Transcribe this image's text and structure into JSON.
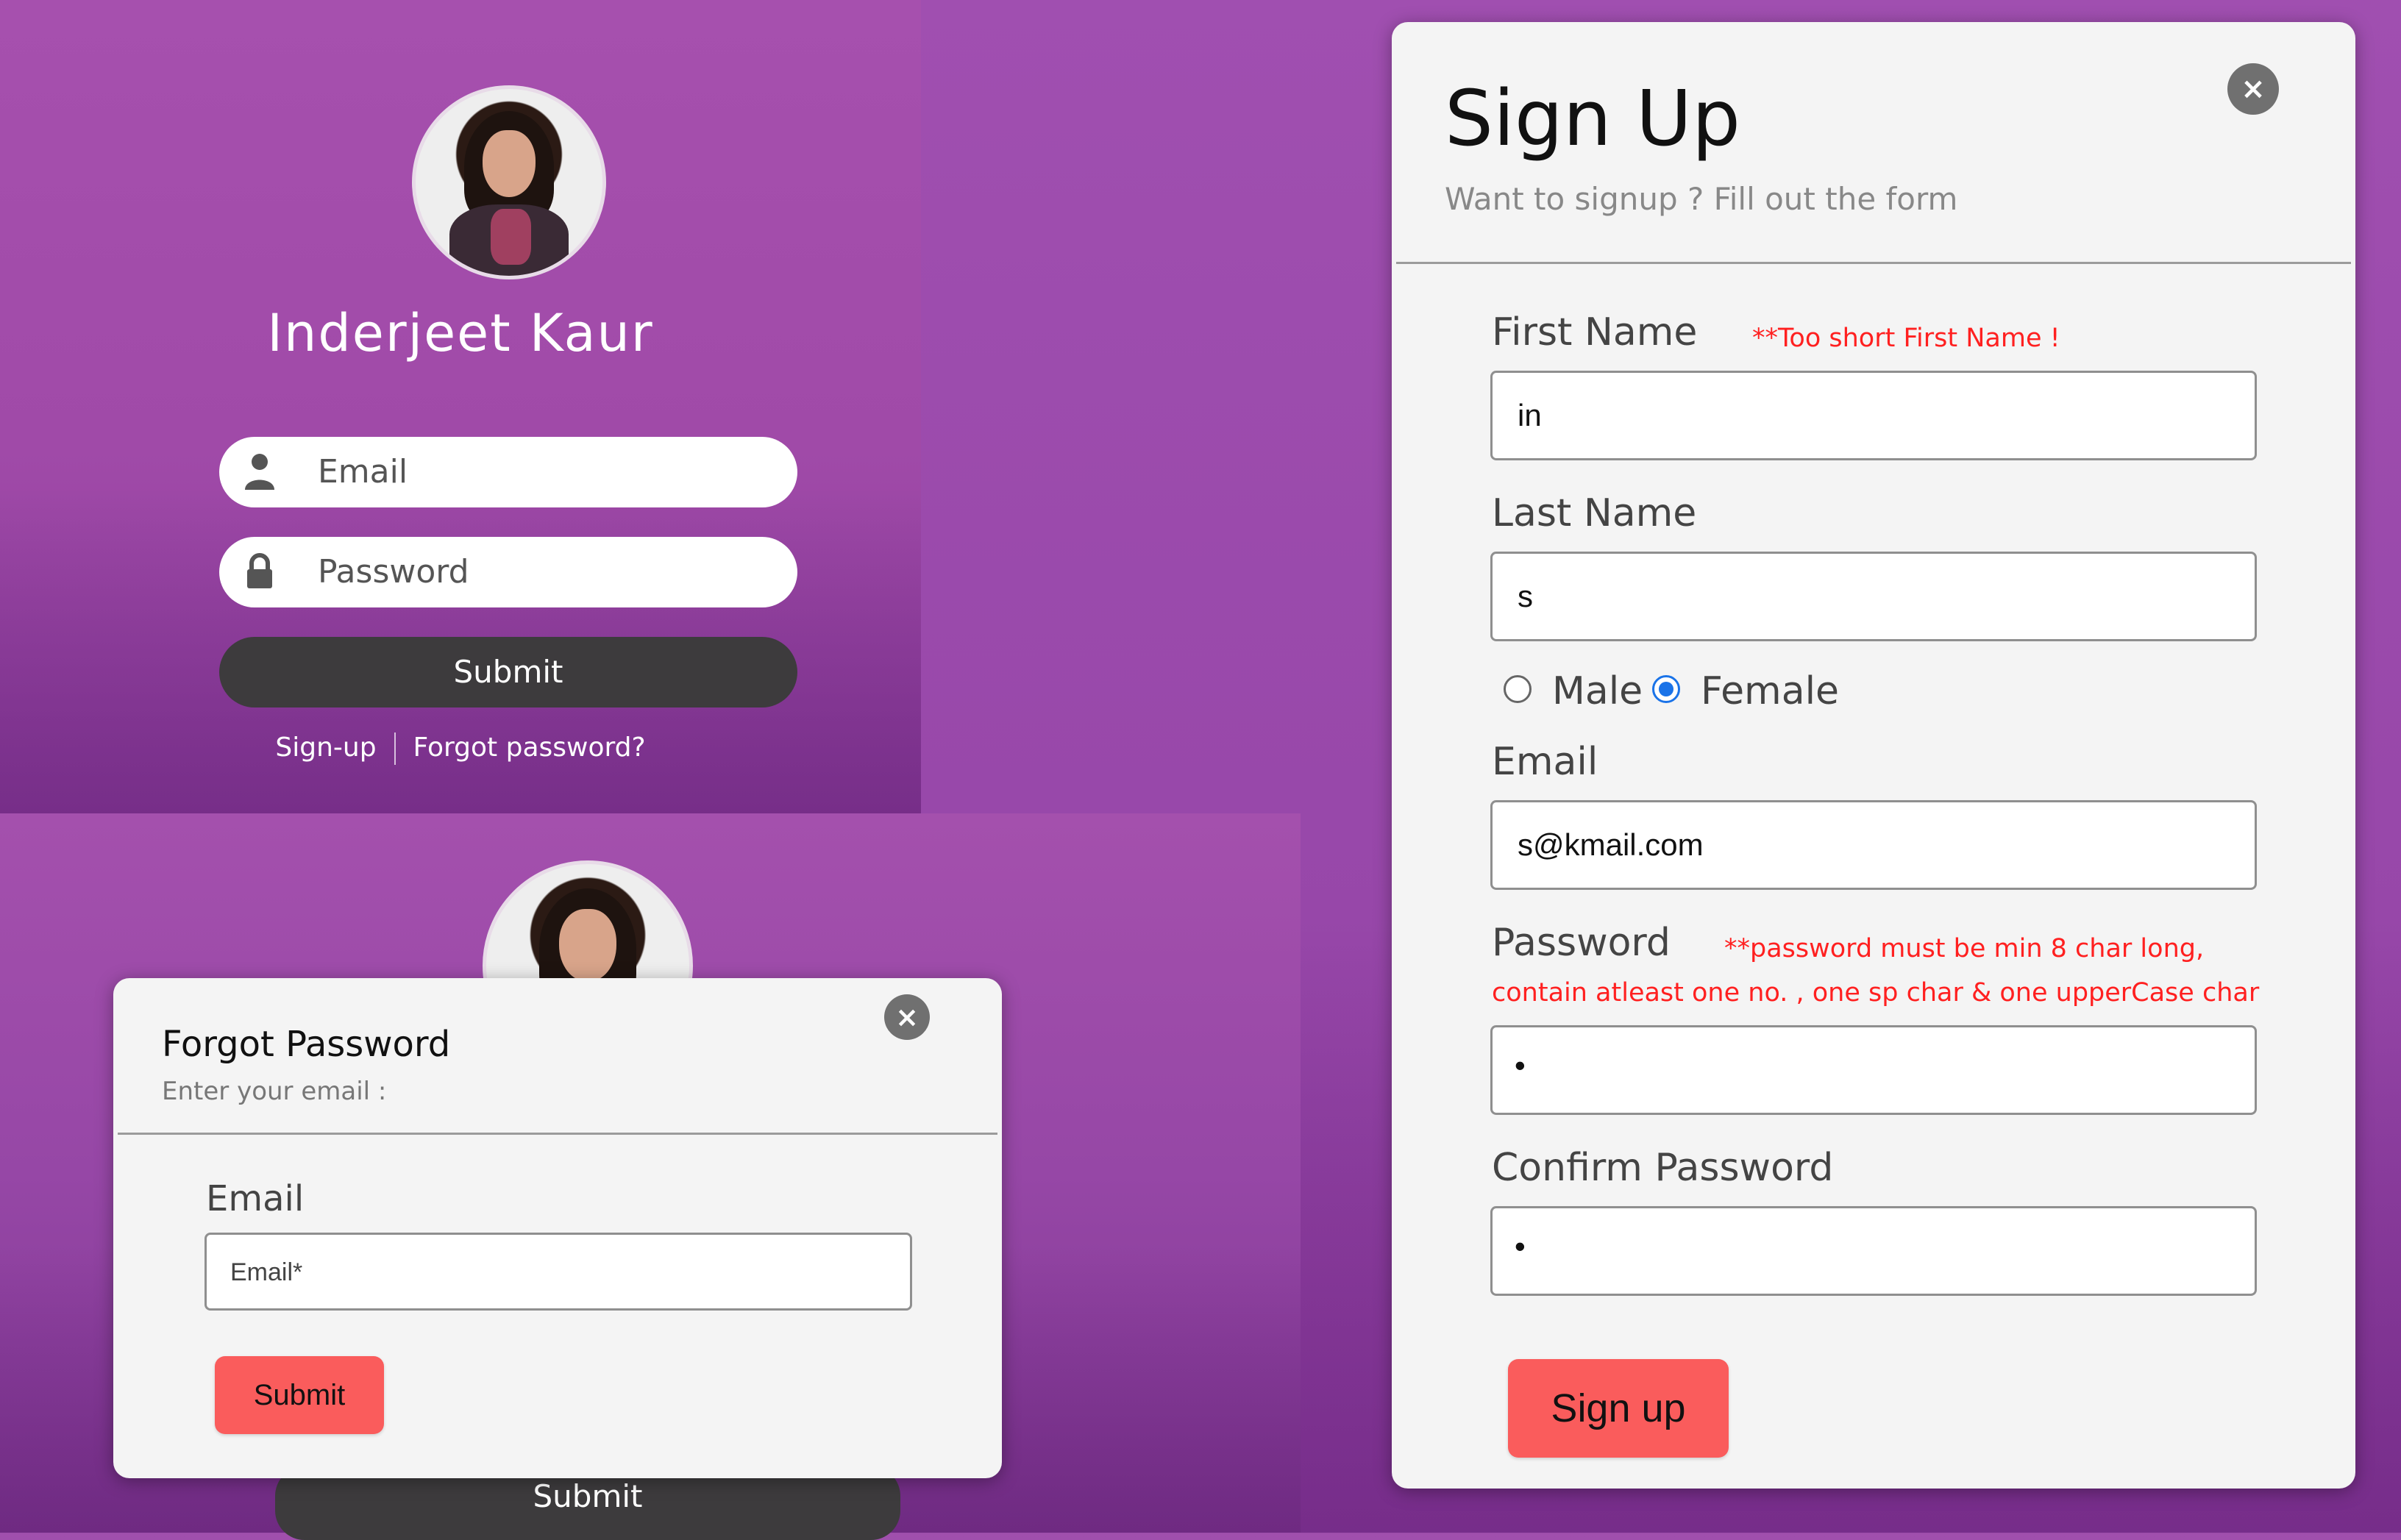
{
  "login": {
    "name": "Inderjeet Kaur",
    "email_placeholder": "Email",
    "password_placeholder": "Password",
    "submit_label": "Submit",
    "signup_link": "Sign-up",
    "forgot_link": "Forgot  password?"
  },
  "background_submit_label": "Submit",
  "forgot_modal": {
    "title": "Forgot Password",
    "subtitle": "Enter your email :",
    "close": "×",
    "email_label": "Email",
    "email_placeholder": "Email*",
    "submit_label": "Submit"
  },
  "signup_modal": {
    "title": "Sign Up",
    "subtitle": "Want to signup ? Fill out the form",
    "close": "×",
    "first_name_label": "First Name",
    "first_name_error": "**Too short First Name !",
    "first_name_value": "in",
    "last_name_label": "Last Name",
    "last_name_value": "s",
    "gender_options": [
      "Male",
      "Female"
    ],
    "gender_selected": "Female",
    "email_label": "Email",
    "email_value": "s@kmail.com",
    "password_label": "Password",
    "password_error_line1": "**password must be min 8 char long,",
    "password_error_line2": "contain atleast one no. , one sp char & one upperCase char",
    "password_value": "•",
    "confirm_password_label": "Confirm Password",
    "confirm_password_value": "•",
    "signup_label": "Sign up"
  },
  "colors": {
    "background_purple": "#a04fad",
    "dark_button": "#3d3b3d",
    "red_button": "#fa5c5c",
    "error_text": "#ff2020",
    "radio_selected": "#1a73e8"
  }
}
